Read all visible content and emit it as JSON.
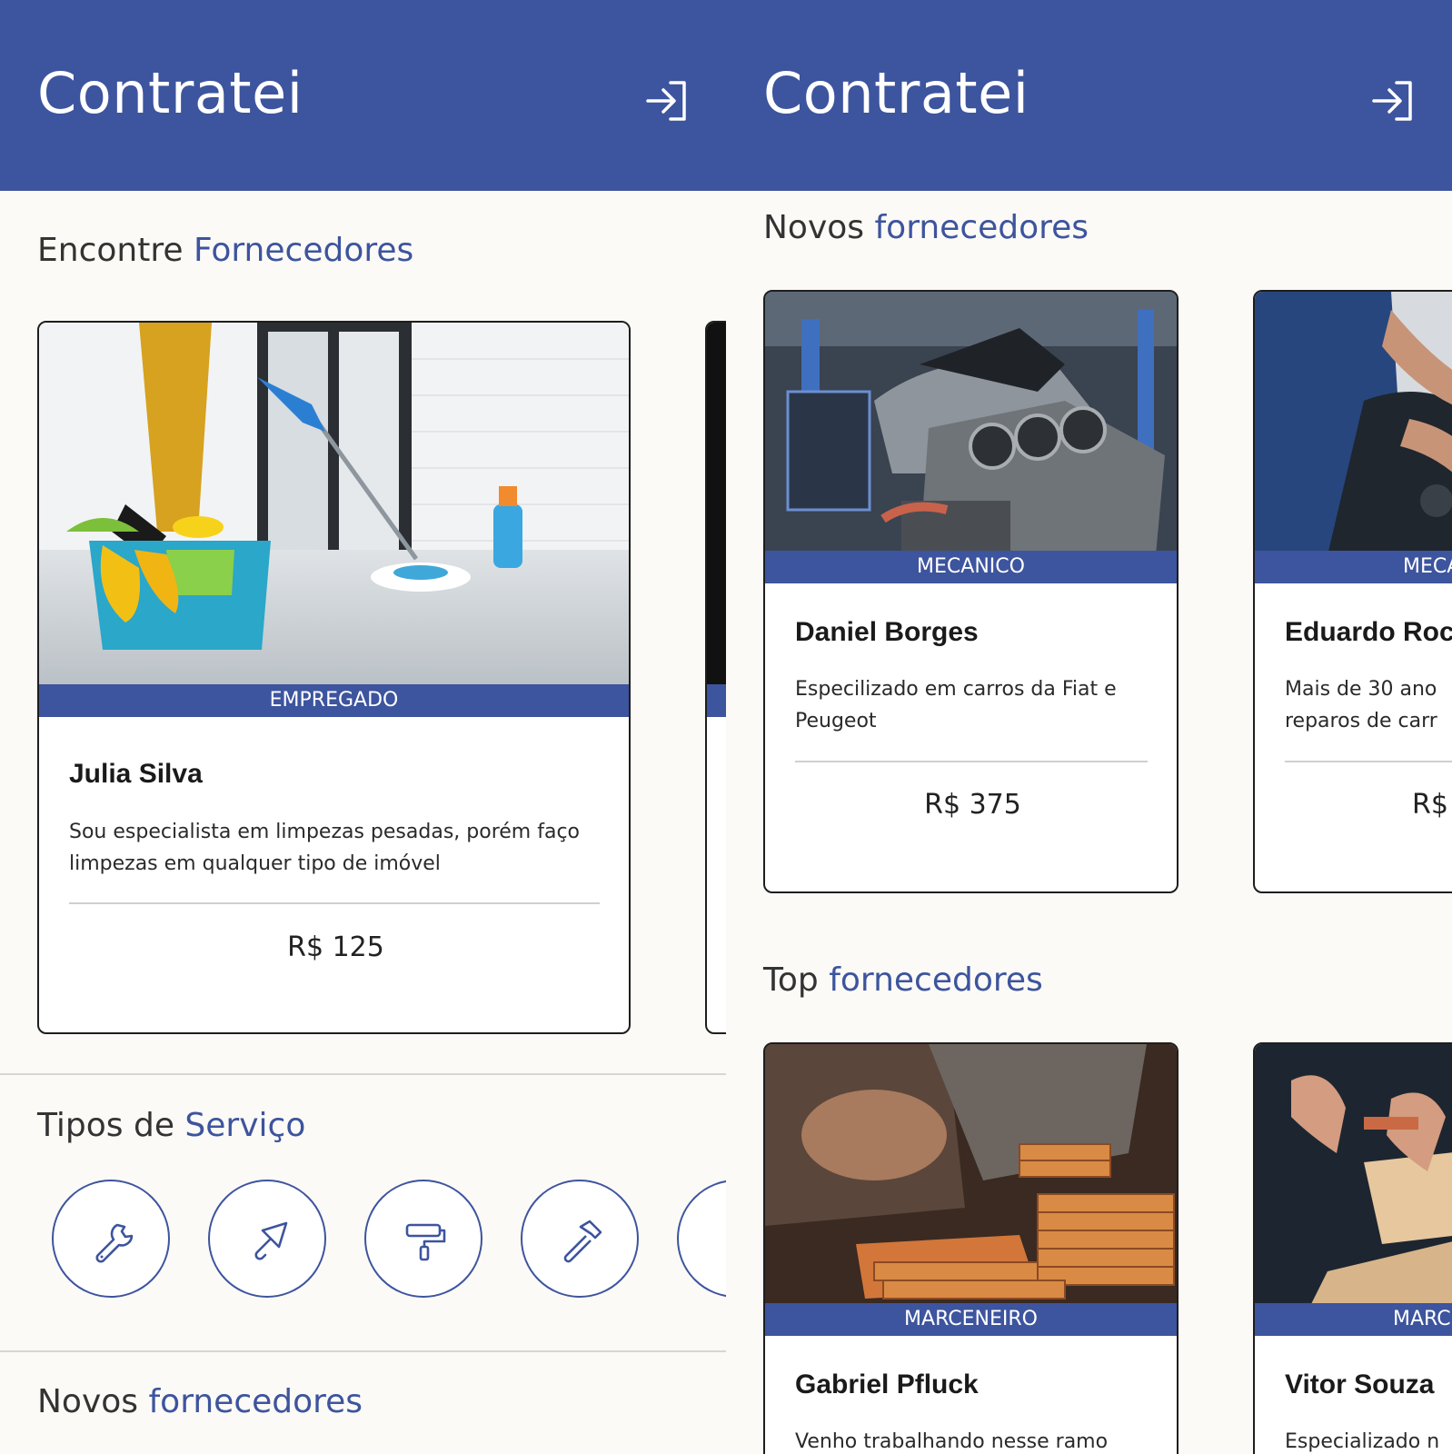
{
  "app": {
    "title": "Contratei",
    "login_icon": "login-icon"
  },
  "left": {
    "section_find": {
      "prefix": "Encontre",
      "accent": "Fornecedores"
    },
    "featured_card": {
      "category": "EMPREGADO",
      "name": "Julia Silva",
      "description": "Sou especialista em limpezas pesadas, porém faço limpezas em qualquer tipo de imóvel",
      "price": "R$ 125",
      "image": "cleaning-photo"
    },
    "section_types": {
      "prefix": "Tipos de",
      "accent": "Serviço"
    },
    "service_types": [
      {
        "icon": "wrench-icon"
      },
      {
        "icon": "trowel-icon"
      },
      {
        "icon": "paint-roller-icon"
      },
      {
        "icon": "hammer-icon"
      },
      {
        "icon": "service-icon"
      }
    ],
    "section_new": {
      "prefix": "Novos",
      "accent": "fornecedores"
    }
  },
  "right": {
    "section_new": {
      "prefix": "Novos",
      "accent": "fornecedores"
    },
    "new_suppliers": [
      {
        "category": "MECANICO",
        "name": "Daniel Borges",
        "description": "Especilizado em carros da Fiat e Peugeot",
        "price": "R$ 375",
        "image": "engine-photo"
      },
      {
        "category": "MECA",
        "name": "Eduardo Roc",
        "description": "Mais de 30 ano reparos de carr",
        "price": "R$",
        "image": "mechanic-photo"
      }
    ],
    "section_top": {
      "prefix": "Top",
      "accent": "fornecedores"
    },
    "top_suppliers": [
      {
        "category": "MARCENEIRO",
        "name": "Gabriel Pfluck",
        "description": "Venho trabalhando nesse ramo",
        "image": "woodwork-photo"
      },
      {
        "category": "MARC",
        "name": "Vitor Souza",
        "description": "Especializado n",
        "image": "carpentry-photo"
      }
    ]
  },
  "colors": {
    "primary": "#3d549e",
    "background": "#fcfaf6",
    "card_border": "#1e1e1e"
  }
}
